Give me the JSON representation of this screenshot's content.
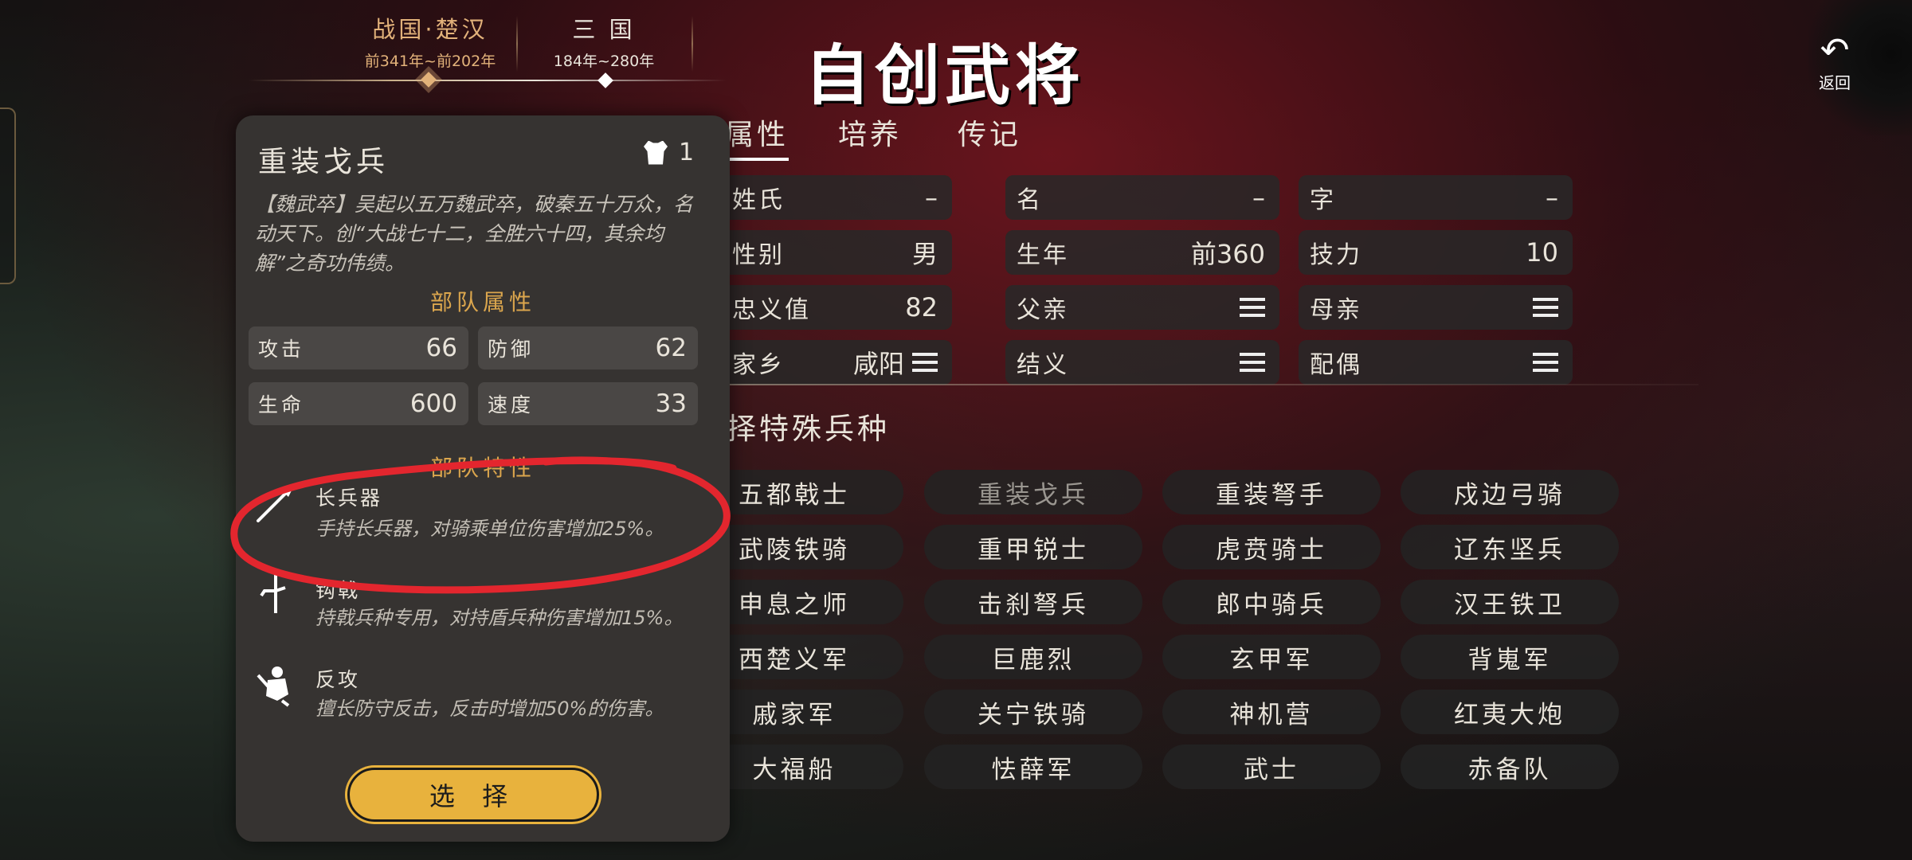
{
  "eras": [
    {
      "name": "战国·楚汉",
      "years": "前341年~前202年"
    },
    {
      "name": "三 国",
      "years": "184年~280年"
    }
  ],
  "title": "自创武将",
  "back_label": "返回",
  "tabs": [
    "属性",
    "培养",
    "传记"
  ],
  "attributes": [
    {
      "label": "姓氏",
      "value": "–"
    },
    {
      "label": "名",
      "value": "–"
    },
    {
      "label": "字",
      "value": "–"
    },
    {
      "label": "性别",
      "value": "男"
    },
    {
      "label": "生年",
      "value": "前360"
    },
    {
      "label": "技力",
      "value": "10"
    },
    {
      "label": "忠义值",
      "value": "82"
    },
    {
      "label": "父亲",
      "value": ""
    },
    {
      "label": "母亲",
      "value": ""
    },
    {
      "label": "家乡",
      "value": "咸阳"
    },
    {
      "label": "结义",
      "value": ""
    },
    {
      "label": "配偶",
      "value": ""
    }
  ],
  "special_title": "择特殊兵种",
  "troops": [
    "五都戟士",
    "重装戈兵",
    "重装弩手",
    "戍边弓骑",
    "武陵铁骑",
    "重甲锐士",
    "虎贲骑士",
    "辽东坚兵",
    "申息之师",
    "击刹弩兵",
    "郎中骑兵",
    "汉王铁卫",
    "西楚义军",
    "巨鹿烈",
    "玄甲军",
    "背嵬军",
    "戚家军",
    "关宁铁骑",
    "神机营",
    "红夷大炮",
    "大福船",
    "怯薛军",
    "武士",
    "赤备队"
  ],
  "panel": {
    "title": "重装戈兵",
    "count": "1",
    "description": "【魏武卒】吴起以五万魏武卒，破秦五十万众，名动天下。创“大战七十二，全胜六十四，其余均解”之奇功伟绩。",
    "stats_title": "部队属性",
    "stats": [
      {
        "label": "攻击",
        "value": "66"
      },
      {
        "label": "防御",
        "value": "62"
      },
      {
        "label": "生命",
        "value": "600"
      },
      {
        "label": "速度",
        "value": "33"
      }
    ],
    "traits_title": "部队特性",
    "traits": [
      {
        "icon": "spear-icon",
        "name": "长兵器",
        "desc": "手持长兵器，对骑乘单位伤害增加25%。"
      },
      {
        "icon": "halberd-icon",
        "name": "钩戟",
        "desc": "持戟兵种专用，对持盾兵种伤害增加15%。"
      },
      {
        "icon": "counterattack-icon",
        "name": "反攻",
        "desc": "擅长防守反击，反击时增加50%的伤害。"
      }
    ],
    "select_label": "选 择"
  },
  "colors": {
    "gold": "#dba64d",
    "active_era": "#e2b27a",
    "button": "#e8b23d",
    "annotation": "#e3262e"
  }
}
